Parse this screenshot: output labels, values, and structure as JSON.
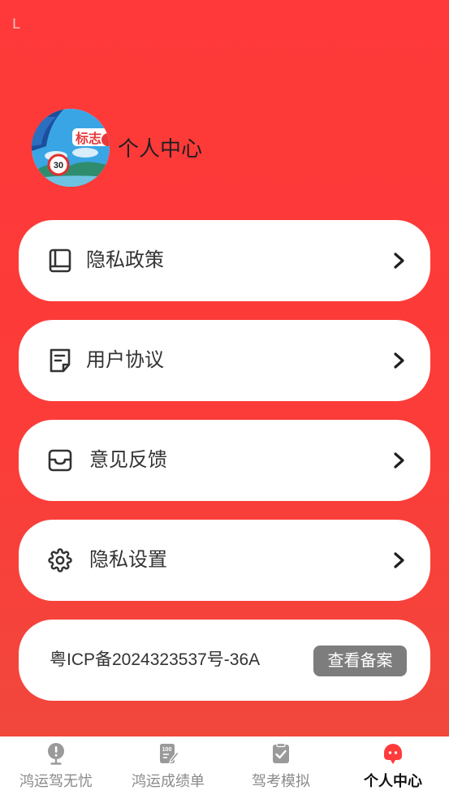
{
  "status_bar": {
    "glyph": "L"
  },
  "profile": {
    "title": "个人中心",
    "avatar": {
      "sign_text": "30",
      "banner_text": "标志"
    }
  },
  "menu": [
    {
      "label": "隐私政策",
      "icon": "book-icon"
    },
    {
      "label": "用户协议",
      "icon": "document-icon"
    },
    {
      "label": "意见反馈",
      "icon": "inbox-icon"
    },
    {
      "label": "隐私设置",
      "icon": "gear-icon"
    }
  ],
  "icp": {
    "text": "粤ICP备2024323537号-36A",
    "button": "查看备案"
  },
  "tabbar": {
    "items": [
      {
        "label": "鸿运驾无忧",
        "icon": "alert-pin-icon"
      },
      {
        "label": "鸿运成绩单",
        "icon": "scorecard-icon",
        "icon_text": "100"
      },
      {
        "label": "驾考模拟",
        "icon": "exam-check-icon"
      },
      {
        "label": "个人中心",
        "icon": "profile-ghost-icon",
        "active": true
      }
    ]
  },
  "colors": {
    "background_top": "#ff3939",
    "background_bottom": "#ef4a3d",
    "card": "#ffffff",
    "icp_button": "#7d7d7d",
    "tab_inactive": "#9a9a9a",
    "tab_active_text": "#111111",
    "tab_active_icon": "#ff3b3b"
  }
}
